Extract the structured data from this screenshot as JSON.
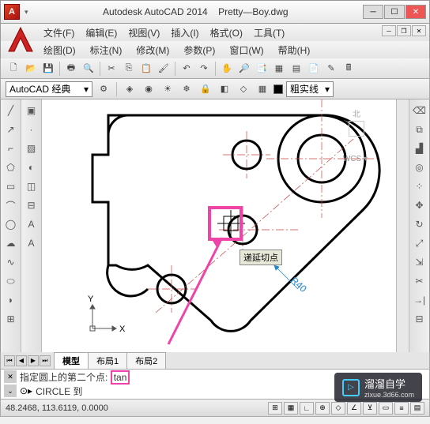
{
  "title": {
    "app": "Autodesk AutoCAD 2014",
    "file": "Pretty—Boy.dwg"
  },
  "menus1": [
    {
      "label": "文件(F)"
    },
    {
      "label": "编辑(E)"
    },
    {
      "label": "视图(V)"
    },
    {
      "label": "插入(I)"
    },
    {
      "label": "格式(O)"
    },
    {
      "label": "工具(T)"
    }
  ],
  "menus2": [
    {
      "label": "绘图(D)"
    },
    {
      "label": "标注(N)"
    },
    {
      "label": "修改(M)"
    },
    {
      "label": "参数(P)"
    },
    {
      "label": "窗口(W)"
    },
    {
      "label": "帮助(H)"
    }
  ],
  "workspace": {
    "selected": "AutoCAD 经典",
    "linestyle": "粗实线"
  },
  "tabs": [
    {
      "label": "模型",
      "active": true
    },
    {
      "label": "布局1",
      "active": false
    },
    {
      "label": "布局2",
      "active": false
    }
  ],
  "command": {
    "prompt": "指定圆上的第二个点:",
    "input": "tan",
    "history_prefix": "CIRCLE 到"
  },
  "tooltip": {
    "text": "递延切点"
  },
  "annotation": {
    "radius": "R40"
  },
  "compass": {
    "n": "北",
    "wcs": "WCS"
  },
  "status": {
    "coords": "48.2468, 113.6119, 0.0000"
  },
  "ucs": {
    "x": "X",
    "y": "Y"
  },
  "watermark": {
    "text": "溜溜自学",
    "sub": "zixue.3d66.com"
  },
  "icons": {
    "min": "─",
    "max": "☐",
    "close": "✕",
    "dropdown": "▾"
  }
}
